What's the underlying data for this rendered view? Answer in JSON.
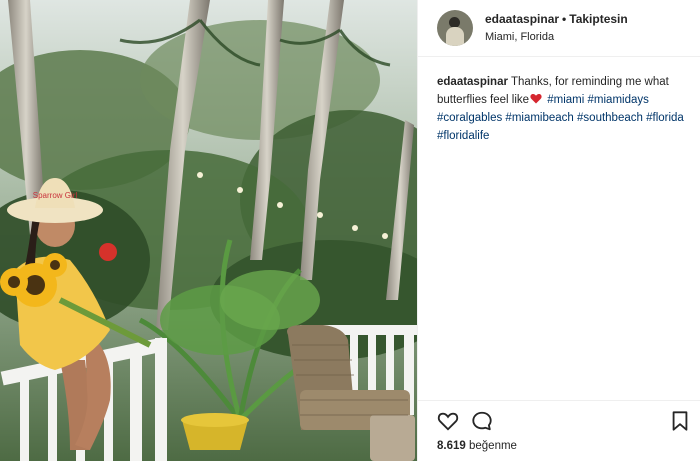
{
  "post": {
    "username": "edaataspinar",
    "separator": "•",
    "follow_status": "Takiptesin",
    "location": "Miami, Florida",
    "caption": {
      "username": "edaataspinar",
      "text_before": "Thanks, for reminding me what butterflies feel like",
      "emoji": "red-heart",
      "hashtags": [
        "#miami",
        "#miamidays",
        "#coralgables",
        "#miamibeach",
        "#southbeach",
        "#florida",
        "#floridalife"
      ]
    },
    "likes_count": "8.619",
    "likes_label": "beğenme"
  },
  "photo": {
    "hat_text": "Sparrow Girl",
    "colors": {
      "dress": "#f2c64a",
      "railing": "#f3f3f1",
      "foliage": "#3f6b33",
      "hat": "#f0e3c2"
    }
  },
  "icons": {
    "like": "heart-outline-icon",
    "comment": "comment-bubble-icon",
    "save": "bookmark-icon"
  }
}
